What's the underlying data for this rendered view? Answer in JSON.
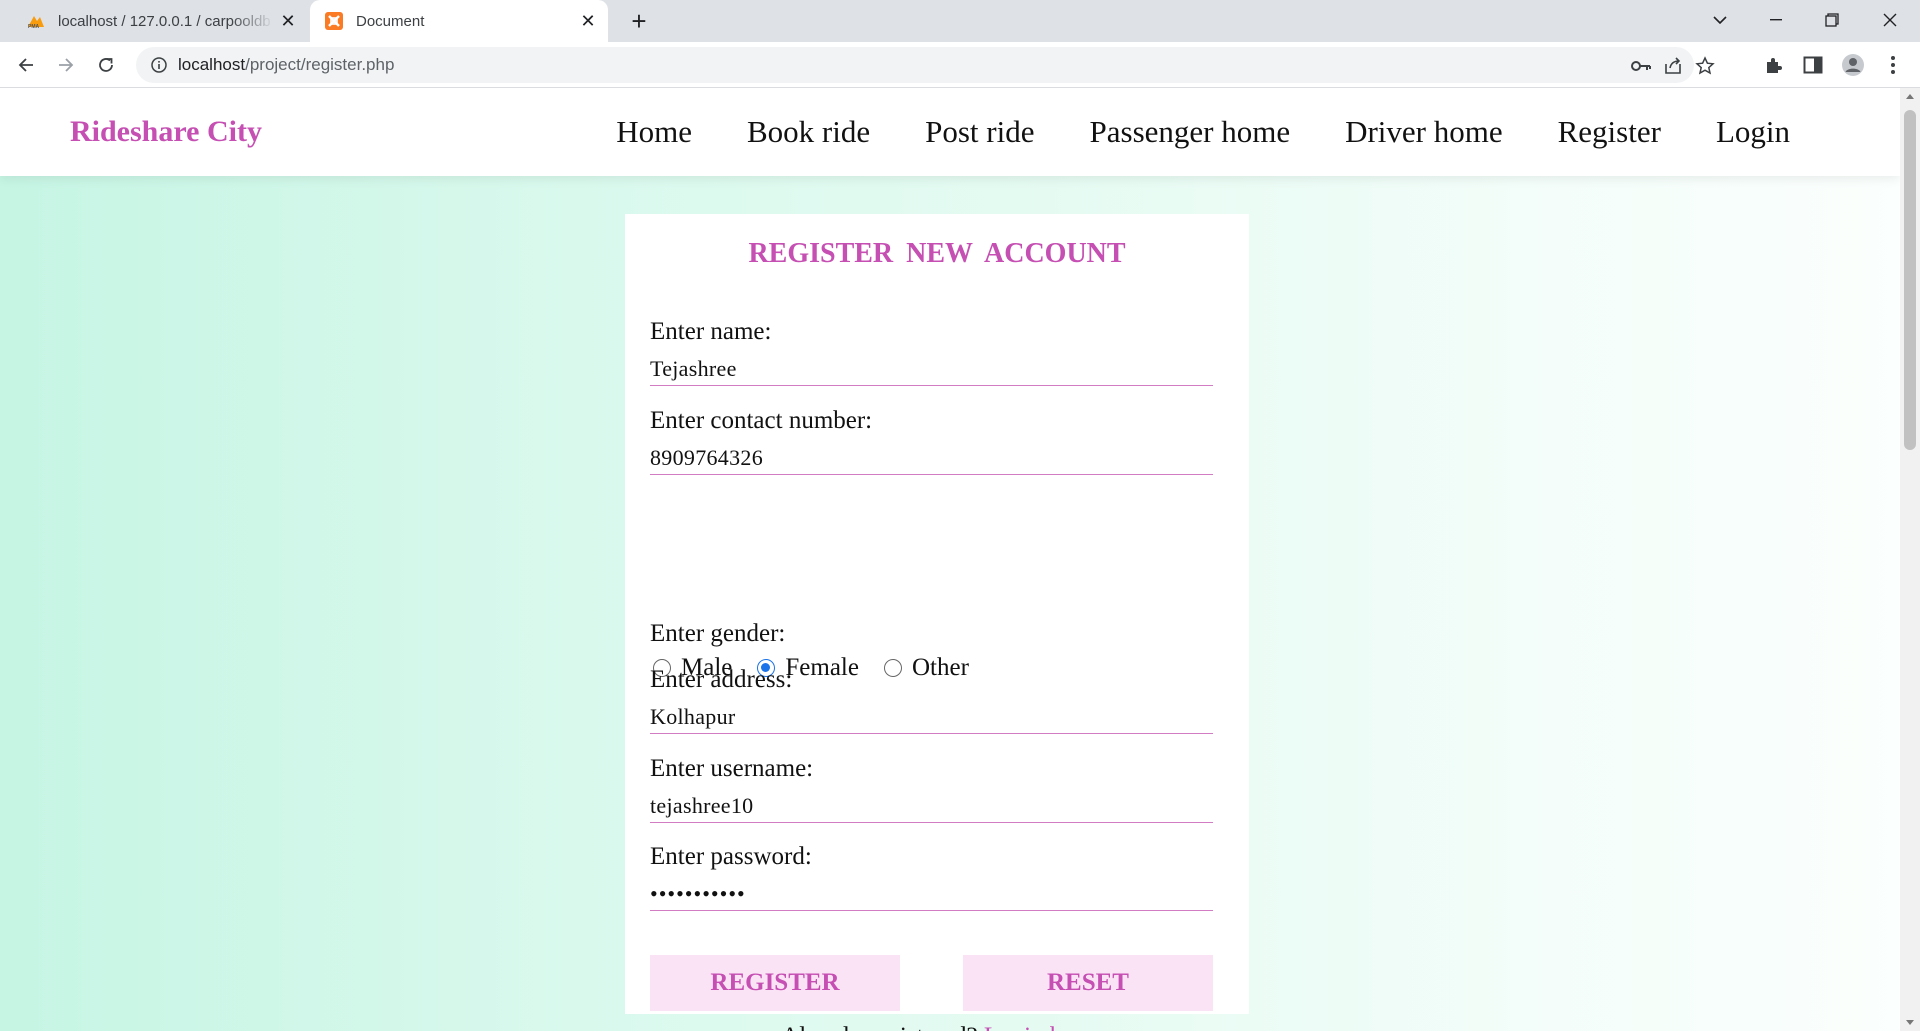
{
  "browser": {
    "tabs": [
      {
        "title": "localhost / 127.0.0.1 / carpooldb",
        "icon": "phpmyadmin-icon",
        "active": false
      },
      {
        "title": "Document",
        "icon": "xampp-icon",
        "active": true
      }
    ],
    "url_host": "localhost",
    "url_path": "/project/register.php"
  },
  "site": {
    "brand": "Rideshare City",
    "nav": {
      "home": "Home",
      "book_ride": "Book ride",
      "post_ride": "Post ride",
      "passenger_home": "Passenger home",
      "driver_home": "Driver home",
      "register": "Register",
      "login": "Login"
    }
  },
  "form": {
    "title": "REGISTER  NEW  ACCOUNT",
    "name": {
      "label": "Enter name:",
      "value": "Tejashree"
    },
    "contact": {
      "label": "Enter contact number:",
      "value": "8909764326"
    },
    "gender": {
      "label": "Enter gender:",
      "options": [
        "Male",
        "Female",
        "Other"
      ],
      "selected": "Female"
    },
    "address": {
      "label": "Enter address:",
      "value": "Kolhapur"
    },
    "username": {
      "label": "Enter username:",
      "value": "tejashree10"
    },
    "password": {
      "label": "Enter password:",
      "value": "•••••••••••"
    },
    "register_button": "REGISTER",
    "reset_button": "RESET",
    "footer_text": "Already registered?",
    "footer_link": "Login here"
  },
  "colors": {
    "brand": "#c54fb2",
    "button_bg": "#fbe3f6",
    "radio_checked": "#1a73e8"
  }
}
